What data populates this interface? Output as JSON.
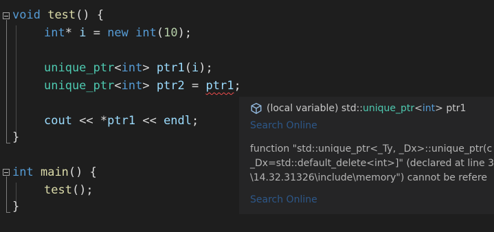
{
  "code": {
    "line1": {
      "kw": "void",
      "fn": "test",
      "p": "() {"
    },
    "line2": {
      "kw1": "int",
      "p1": "*",
      "var": "i",
      "p2": " = ",
      "kw2": "new",
      "kw3": "int",
      "p3": "(",
      "num": "10",
      "p4": ");"
    },
    "line4": {
      "ty": "unique_ptr",
      "p1": "<",
      "kw": "int",
      "p2": "> ",
      "var1": "ptr1",
      "p3": "(",
      "var2": "i",
      "p4": ");"
    },
    "line5": {
      "ty": "unique_ptr",
      "p1": "<",
      "kw": "int",
      "p2": "> ",
      "var1": "ptr2",
      "p3": " = ",
      "var2": "ptr1",
      "p4": ";"
    },
    "line7": {
      "var1": "cout",
      "p1": " << ",
      "p2": "*",
      "var2": "ptr1",
      "p3": " << ",
      "var3": "endl",
      "p4": ";"
    },
    "line8": {
      "p": "}"
    },
    "line10": {
      "kw": "int",
      "fn": "main",
      "p": "() {"
    },
    "line11": {
      "fn": "test",
      "p": "();"
    },
    "line12": {
      "p": "}"
    }
  },
  "tooltip": {
    "signature_prefix": "(local variable) std::",
    "signature_type": "unique_ptr",
    "signature_lt": "<",
    "signature_kw": "int",
    "signature_gt": "> ptr1",
    "search_online_1": "Search Online",
    "error_line1": "function \"std::unique_ptr<_Ty, _Dx>::unique_ptr(c",
    "error_line2": "_Dx=std::default_delete<int>]\" (declared at line 3",
    "error_line3": "\\14.32.31326\\include\\memory\") cannot be refere",
    "search_online_2": "Search Online"
  },
  "icons": {
    "variable": "local-variable-icon",
    "fold": "collapse-icon"
  }
}
